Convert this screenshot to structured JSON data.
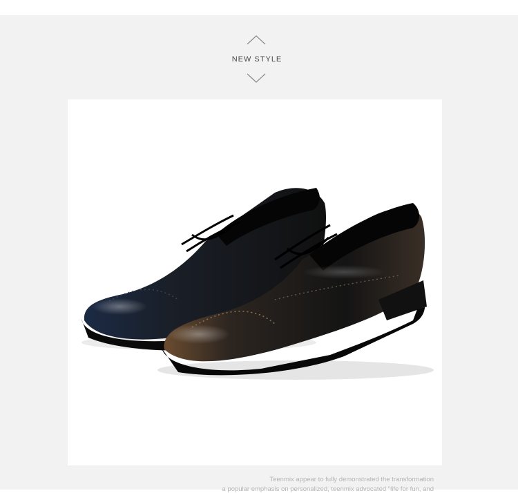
{
  "section": {
    "heading": "NEW STYLE",
    "up_icon": "chevron-up-icon",
    "down_icon": "chevron-down-icon"
  },
  "product_photo": {
    "subject": "brogue-oxford-shoes-pair",
    "colors": {
      "background": "#ffffff",
      "shoe_left": "#1a2233",
      "shoe_right": "#2a221c",
      "toe_burnish": "#7a5a3a"
    }
  },
  "caption": {
    "line1": "Teenmix appear to fully demonstrated the transformation",
    "line2": "a popular emphasis on personalized, teenmix advocated \"life for fun, and"
  },
  "colors": {
    "page_background": "#f2f2f2",
    "heading_text": "#4a4a4a",
    "caption_text": "#b5b5b5"
  }
}
